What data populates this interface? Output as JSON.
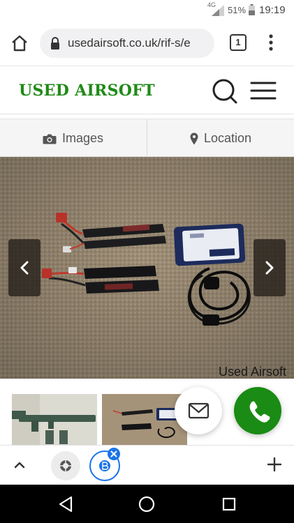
{
  "status_bar": {
    "network": "4G",
    "battery_percent": "51%",
    "time": "19:19"
  },
  "browser": {
    "url": "usedairsoft.co.uk/rif-s/e",
    "tab_count": "1",
    "icons": [
      "home-icon",
      "lock-icon",
      "tab-switcher-icon",
      "kebab-menu-icon"
    ]
  },
  "site": {
    "logo_text": "USED AIRSOFT",
    "logo_color": "#1f8a16",
    "icons": [
      "search-icon",
      "hamburger-menu-icon"
    ]
  },
  "segments": {
    "images_label": "Images",
    "location_label": "Location",
    "icons": [
      "camera-icon",
      "map-pin-icon"
    ]
  },
  "gallery": {
    "watermark": "Used Airsoft",
    "icons": [
      "chevron-left-icon",
      "chevron-right-icon"
    ]
  },
  "actions": {
    "call_color": "#1a8b14",
    "icons": [
      "mail-icon",
      "phone-icon"
    ]
  },
  "tab_strip": {
    "icons": [
      "chevron-up-icon",
      "site-favicon-icon",
      "close-icon",
      "plus-icon"
    ]
  },
  "nav": {
    "icons": [
      "back-icon",
      "home-circle-icon",
      "recents-icon"
    ]
  }
}
